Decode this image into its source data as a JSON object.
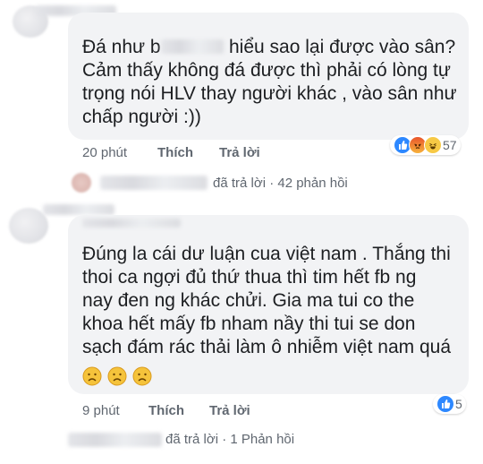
{
  "comments": [
    {
      "text_lines": [
        "Đá như b",
        "hiểu sao lại được vào sân?",
        "Cảm thấy không đá được thì phải có lòng tự",
        "trọng nói HLV thay người khác , vào sân như",
        "chấp người :))"
      ],
      "time": "20 phút",
      "like_label": "Thích",
      "reply_label": "Trả lời",
      "reaction_count": "57",
      "reactions": [
        "like-icon",
        "angry-icon",
        "haha-icon"
      ],
      "replies_suffix": "đã trả lời · 42 phản hồi"
    },
    {
      "text_lines": [
        "Đúng la cái dư luận cua việt nam . Thắng thi",
        "thoi ca ngợi đủ thứ thua thì tim hết fb ng",
        "nay đen ng khác chửi. Gia ma tui co the",
        "khoa hết mấy fb nham nầy thi tui se don",
        "sạch đám rác thải làm ô nhiễm việt nam quá"
      ],
      "emoji_row": [
        "sad-face",
        "sad-face",
        "sad-face"
      ],
      "time": "9 phút",
      "like_label": "Thích",
      "reply_label": "Trả lời",
      "reaction_count": "5",
      "reactions": [
        "like-icon"
      ],
      "replies_suffix": "đã trả lời · 1 Phản hồi"
    }
  ],
  "colors": {
    "bubble": "#f2f3f5",
    "meta_text": "#606770",
    "link_blue": "#385898",
    "like_blue": "#2d88ff",
    "angry_orange": "#f0703a",
    "haha_yellow": "#f7c945"
  }
}
